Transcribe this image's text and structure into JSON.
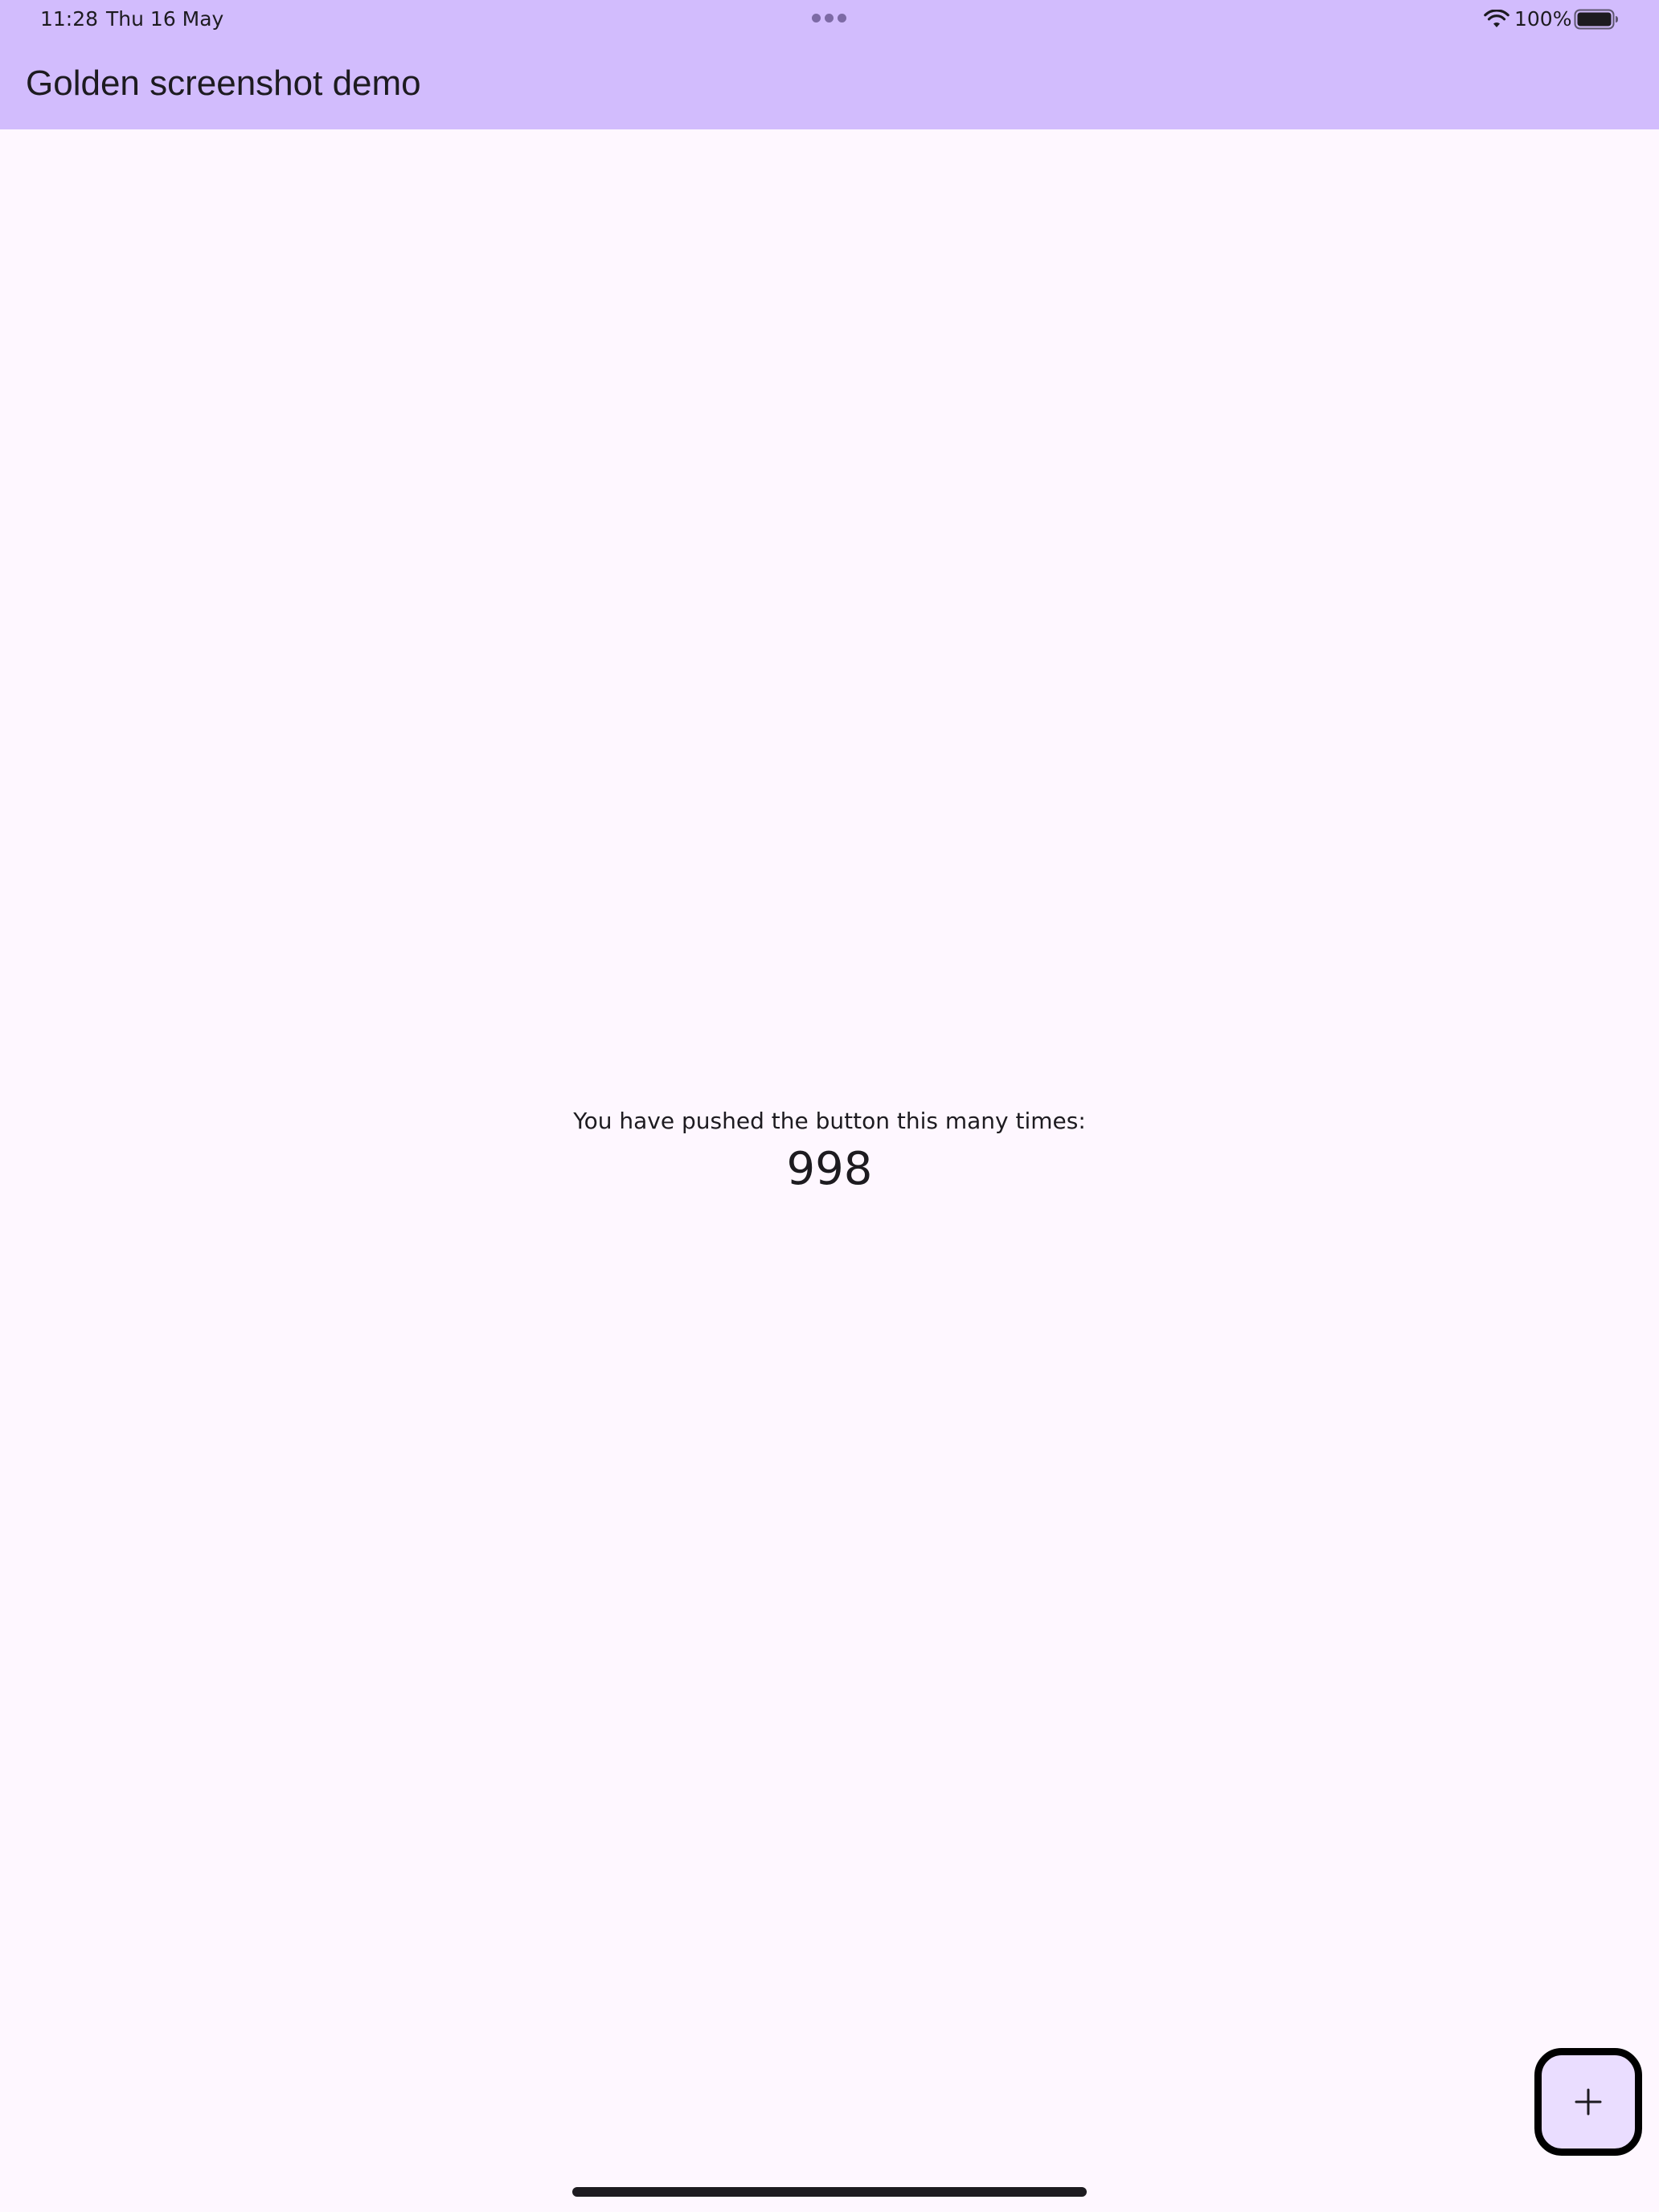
{
  "status_bar": {
    "time": "11:28",
    "date": "Thu 16 May",
    "battery_percent": "100%",
    "icons": [
      "multitask-dots-icon",
      "wifi-icon",
      "battery-icon"
    ]
  },
  "app_bar": {
    "title": "Golden screenshot demo"
  },
  "main": {
    "counter_label": "You have pushed the button this many times:",
    "counter_value": "998"
  },
  "fab": {
    "icon": "plus-icon"
  },
  "colors": {
    "app_bar": "#d2bcfd",
    "background": "#fef7ff",
    "fab_fill": "#eaddff",
    "text": "#1d1b20"
  }
}
